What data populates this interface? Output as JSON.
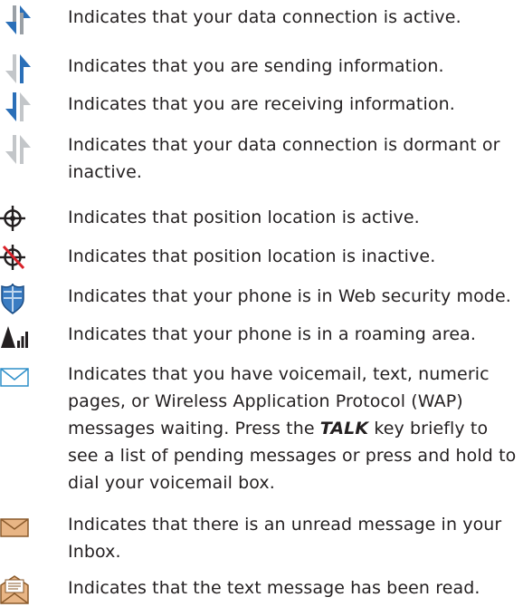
{
  "items": [
    {
      "icon": "data-active-icon",
      "text": "Indicates that your data connection is active."
    },
    {
      "icon": "data-sending-icon",
      "text": "Indicates that you are sending information."
    },
    {
      "icon": "data-receiving-icon",
      "text": "Indicates that you are receiving information."
    },
    {
      "icon": "data-dormant-icon",
      "text": "Indicates that your data connection is dormant or inactive."
    },
    {
      "icon": "location-active-icon",
      "text": "Indicates that position location is active."
    },
    {
      "icon": "location-inactive-icon",
      "text": "Indicates that position location is inactive."
    },
    {
      "icon": "security-shield-icon",
      "text": "Indicates that your phone is in Web security mode."
    },
    {
      "icon": "roaming-icon",
      "text": "Indicates that your phone is in a roaming area."
    },
    {
      "icon": "voicemail-envelope-icon",
      "text_before": "Indicates that you have voicemail, text, numeric pages, or Wireless Application Protocol (WAP) messages waiting. Press the ",
      "key": "TALK",
      "text_after": " key briefly to see a list of pending messages or press and hold to dial your voicemail box."
    },
    {
      "icon": "unread-message-icon",
      "text": "Indicates that there is an unread message in your Inbox."
    },
    {
      "icon": "read-message-icon",
      "text": "Indicates that the text message has been read."
    }
  ],
  "colors": {
    "arrow_blue": "#2a6fb8",
    "arrow_dark": "#1e5a9a",
    "arrow_gray": "#a7a9ac",
    "shield_blue": "#3a7cc2",
    "envelope_outline": "#2e8fc9",
    "envelope_tan": "#e8b585",
    "envelope_brown": "#8a5a2b",
    "no_red": "#d9222a",
    "text": "#231f20"
  }
}
